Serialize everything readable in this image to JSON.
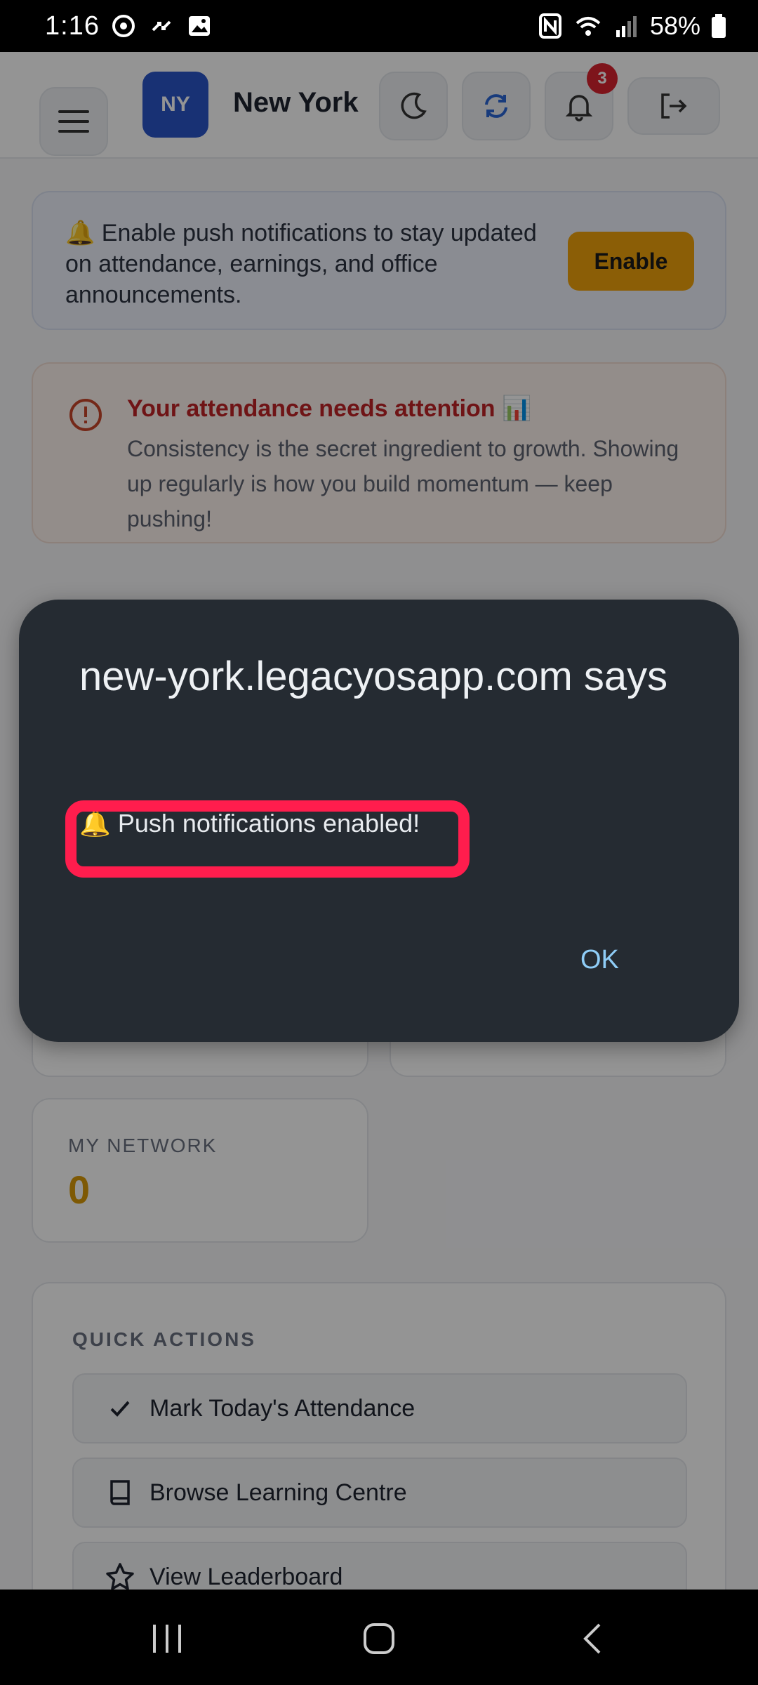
{
  "status_bar": {
    "time": "1:16",
    "battery": "58%"
  },
  "header": {
    "avatar_initials": "NY",
    "office_name": "New York",
    "notification_count": "3"
  },
  "push_banner": {
    "text": "🔔 Enable push notifications to stay updated on attendance, earnings, and office announcements.",
    "button_label": "Enable"
  },
  "attendance_alert": {
    "title": "Your attendance needs attention 📊",
    "body": "Consistency is the secret ingredient to growth. Showing up regularly is how you build momentum — keep pushing!"
  },
  "network": {
    "label": "MY NETWORK",
    "value": "0"
  },
  "quick_actions": {
    "title": "QUICK ACTIONS",
    "items": [
      {
        "label": "Mark Today's Attendance",
        "icon": "check-icon"
      },
      {
        "label": "Browse Learning Centre",
        "icon": "book-icon"
      },
      {
        "label": "View Leaderboard",
        "icon": "star-icon"
      }
    ]
  },
  "dialog": {
    "title": "new-york.legacyosapp.com says",
    "message": "🔔 Push notifications enabled!",
    "ok_label": "OK"
  },
  "colors": {
    "accent_blue": "#2a55c9",
    "enable_yellow": "#f0a20b",
    "alert_red": "#c02326",
    "highlight": "#ff1d4d",
    "dialog_bg": "#252b32",
    "ok_text": "#8fcdf7"
  }
}
